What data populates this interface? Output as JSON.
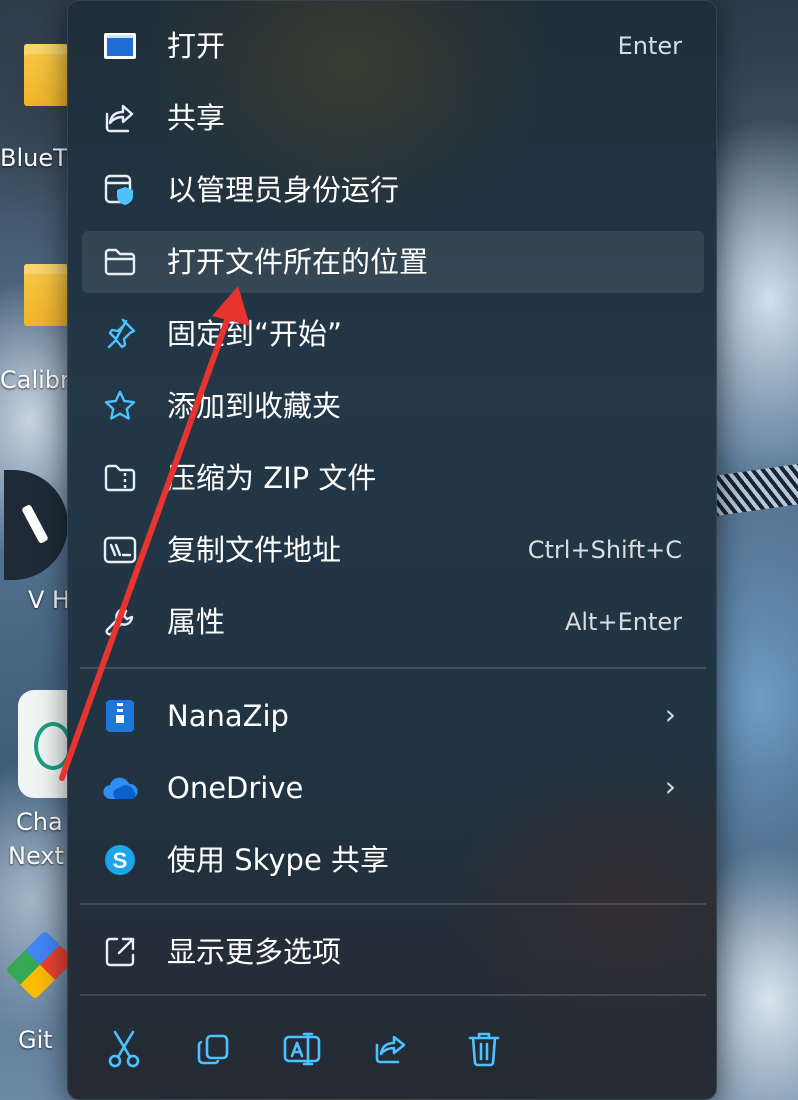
{
  "desktop": {
    "icons": [
      {
        "label": "BlueT"
      },
      {
        "label": "Calibr"
      },
      {
        "label": "V H"
      },
      {
        "label": "Cha"
      },
      {
        "label": "Next"
      },
      {
        "label": "Git"
      }
    ]
  },
  "menu": {
    "items": [
      {
        "label": "打开",
        "shortcut": "Enter",
        "icon": "open-app-icon"
      },
      {
        "label": "共享",
        "icon": "share-icon"
      },
      {
        "label": "以管理员身份运行",
        "icon": "run-as-admin-shield-icon"
      },
      {
        "label": "打开文件所在的位置",
        "icon": "folder-icon",
        "highlighted": true
      },
      {
        "label": "固定到“开始”",
        "icon": "pin-icon"
      },
      {
        "label": "添加到收藏夹",
        "icon": "star-icon"
      },
      {
        "label": "压缩为 ZIP 文件",
        "icon": "zip-folder-icon"
      },
      {
        "label": "复制文件地址",
        "shortcut": "Ctrl+Shift+C",
        "icon": "copy-path-icon"
      },
      {
        "label": "属性",
        "shortcut": "Alt+Enter",
        "icon": "wrench-icon"
      }
    ],
    "apps": [
      {
        "label": "NanaZip",
        "submenu": true,
        "icon": "nanazip-icon"
      },
      {
        "label": "OneDrive",
        "submenu": true,
        "icon": "onedrive-cloud-icon"
      },
      {
        "label": "使用 Skype 共享",
        "icon": "skype-icon"
      }
    ],
    "more": {
      "label": "显示更多选项",
      "icon": "show-more-options-icon"
    },
    "toolbar": [
      "cut-icon",
      "copy-icon",
      "rename-icon",
      "share-icon",
      "delete-icon"
    ],
    "submenu_chevron": "›"
  },
  "colors": {
    "accent": "#4cc2ff",
    "annotation_arrow": "#e8332f",
    "text": "#ffffff"
  }
}
